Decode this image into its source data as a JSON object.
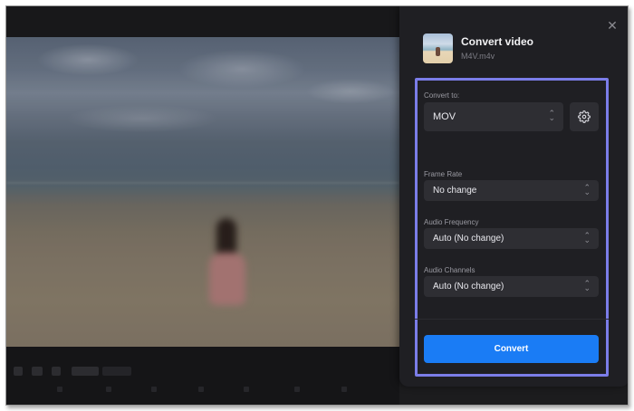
{
  "panel": {
    "title": "Convert video",
    "file_name": "M4V.m4v",
    "convert_to_label": "Convert to:",
    "format_value": "MOV",
    "frame_rate_label": "Frame Rate",
    "frame_rate_value": "No change",
    "audio_frequency_label": "Audio Frequency",
    "audio_frequency_value": "Auto (No change)",
    "audio_channels_label": "Audio Channels",
    "audio_channels_value": "Auto (No change)",
    "convert_button": "Convert",
    "close_glyph": "✕"
  },
  "icons": {
    "close": "close-icon",
    "settings": "gear-icon",
    "dropdown": "chevron-updown-icon"
  },
  "colors": {
    "accent": "#1a7cf5",
    "highlight_outline": "#7b7de8",
    "panel_bg": "#1f1f23"
  }
}
